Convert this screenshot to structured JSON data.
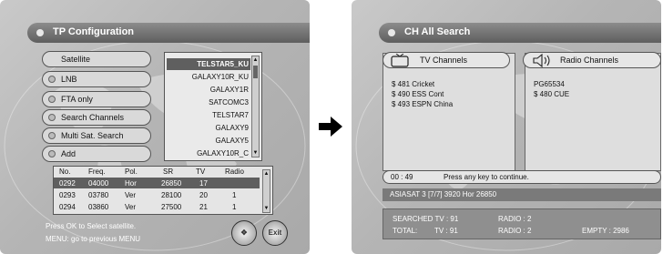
{
  "left": {
    "title": "TP Configuration",
    "menu": [
      "Satellite",
      "LNB",
      "FTA only",
      "Search Channels",
      "Multi Sat. Search",
      "Add"
    ],
    "satellites": [
      "TELSTAR5_KU",
      "GALAXY10R_KU",
      "GALAXY1R",
      "SATCOMC3",
      "TELSTAR7",
      "GALAXY9",
      "GALAXY5",
      "GALAXY10R_C"
    ],
    "selected_satellite": "TELSTAR5_KU",
    "table_headers": [
      "No.",
      "Freq.",
      "Pol.",
      "SR",
      "TV",
      "Radio"
    ],
    "table_rows": [
      [
        "0292",
        "04000",
        "Hor",
        "26850",
        "17",
        ""
      ],
      [
        "0293",
        "03780",
        "Ver",
        "28100",
        "20",
        "1"
      ],
      [
        "0294",
        "03860",
        "Ver",
        "27500",
        "21",
        "1"
      ]
    ],
    "hint_1": "Press OK to Select satellite.",
    "hint_2": "MENU: go to previous MENU",
    "exit_label": "Exit"
  },
  "right": {
    "title": "CH All Search",
    "tv_header": "TV Channels",
    "radio_header": "Radio Channels",
    "tv_channels": [
      "$ 481 Cricket",
      "$ 490 ESS Cont",
      "$ 493 ESPN China"
    ],
    "radio_channels": [
      "PG65534",
      "$ 480 CUE"
    ],
    "time": "00 : 49",
    "prompt": "Press any key to continue.",
    "status": "ASIASAT 3 [7/7] 3920 Hor 26850",
    "summary": {
      "searched_tv_label": "SEARCHED TV : 91",
      "radio_label_1": "RADIO : 2",
      "total_label": "TOTAL:",
      "total_tv": "TV : 91",
      "radio_label_2": "RADIO : 2",
      "empty": "EMPTY : 2986"
    }
  }
}
